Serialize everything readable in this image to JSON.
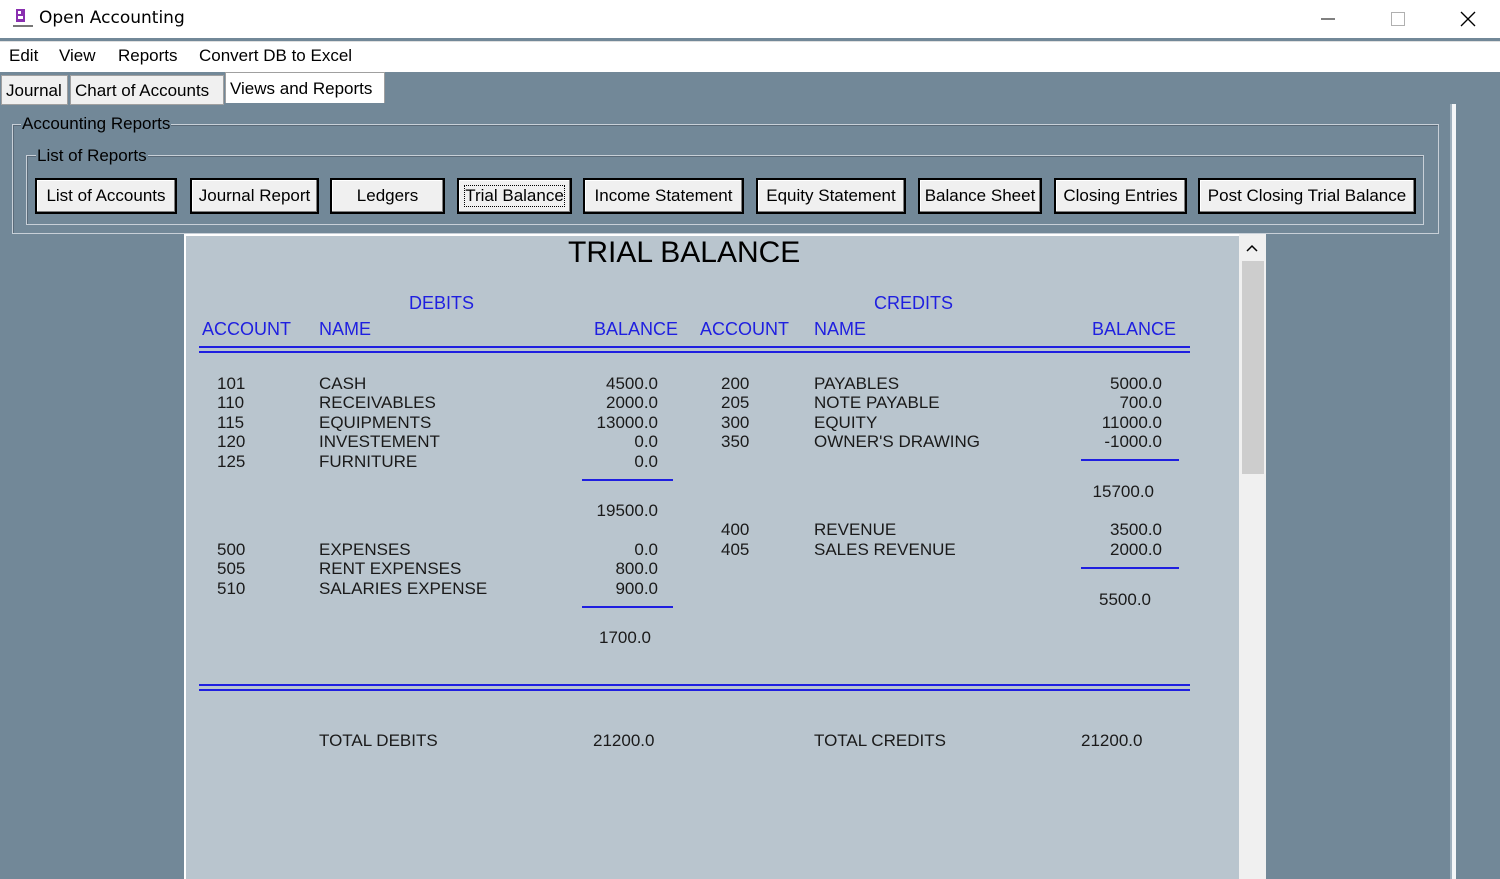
{
  "window": {
    "title": "Open Accounting",
    "minimize_icon": "minimize-icon",
    "maximize_icon": "maximize-icon",
    "close_icon": "close-icon"
  },
  "menu": [
    "Edit",
    "View",
    "Reports",
    "Convert DB to Excel"
  ],
  "tabs": [
    "Journal",
    "Chart of Accounts",
    "Views and Reports"
  ],
  "active_tab": "Views and Reports",
  "groups": {
    "outer": "Accounting Reports",
    "inner": "List of Reports"
  },
  "report_buttons": [
    "List of Accounts",
    "Journal Report",
    "Ledgers",
    "Trial Balance",
    "Income Statement",
    "Equity Statement",
    "Balance Sheet",
    "Closing Entries",
    "Post Closing Trial Balance"
  ],
  "selected_report": "Trial Balance",
  "report": {
    "title": "TRIAL BALANCE",
    "debits_heading": "DEBITS",
    "credits_heading": "CREDITS",
    "col_account": "ACCOUNT",
    "col_name": "NAME",
    "col_balance": "BALANCE",
    "debit_group1": {
      "accounts": [
        "101",
        "110",
        "115",
        "120",
        "125"
      ],
      "names": [
        "CASH",
        "RECEIVABLES",
        "EQUIPMENTS",
        "INVESTEMENT",
        "FURNITURE"
      ],
      "balances": [
        "4500.0",
        "2000.0",
        "13000.0",
        "0.0",
        "0.0"
      ],
      "subtotal": "19500.0"
    },
    "debit_group2": {
      "accounts": [
        "500",
        "505",
        "510"
      ],
      "names": [
        "EXPENSES",
        "RENT EXPENSES",
        "SALARIES EXPENSE"
      ],
      "balances": [
        "0.0",
        "800.0",
        "900.0"
      ],
      "subtotal": "1700.0"
    },
    "credit_group1": {
      "accounts": [
        "200",
        "205",
        "300",
        "350"
      ],
      "names": [
        "PAYABLES",
        "NOTE PAYABLE",
        "EQUITY",
        "OWNER'S DRAWING"
      ],
      "balances": [
        "5000.0",
        "700.0",
        "11000.0",
        "-1000.0"
      ],
      "subtotal": "15700.0"
    },
    "credit_group2": {
      "accounts": [
        "400",
        "405"
      ],
      "names": [
        "REVENUE",
        "SALES REVENUE"
      ],
      "balances": [
        "3500.0",
        "2000.0"
      ],
      "subtotal": "5500.0"
    },
    "total_debits_label": "TOTAL DEBITS",
    "total_debits": "21200.0",
    "total_credits_label": "TOTAL CREDITS",
    "total_credits": "21200.0"
  },
  "colors": {
    "background": "#728898",
    "report_bg": "#b9c5ce",
    "heading_blue": "#1f1fe0"
  }
}
